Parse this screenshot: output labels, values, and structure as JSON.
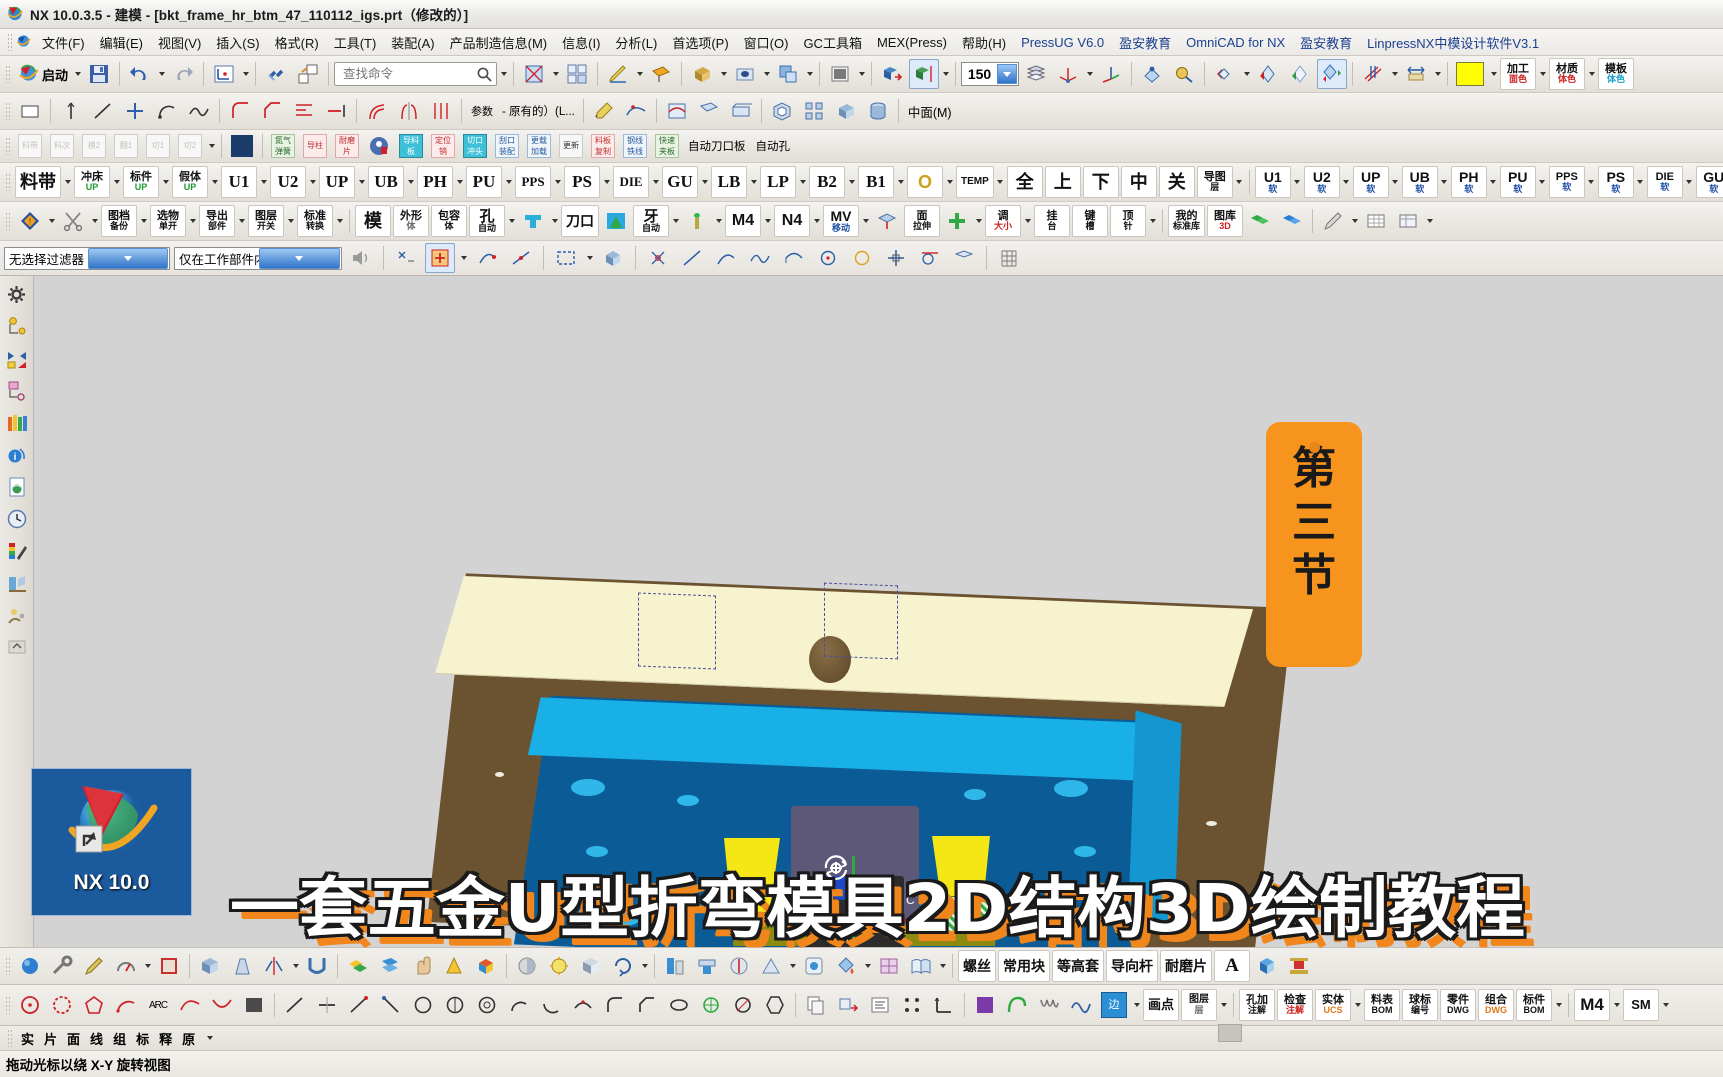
{
  "window": {
    "title": "NX 10.0.3.5 - 建模 - [bkt_frame_hr_btm_47_110112_igs.prt（修改的）]",
    "app_icon": "nx-globe-icon"
  },
  "menubar": {
    "items": [
      {
        "label": "文件(F)",
        "accent": false
      },
      {
        "label": "编辑(E)",
        "accent": false
      },
      {
        "label": "视图(V)",
        "accent": false
      },
      {
        "label": "插入(S)",
        "accent": false
      },
      {
        "label": "格式(R)",
        "accent": false
      },
      {
        "label": "工具(T)",
        "accent": false
      },
      {
        "label": "装配(A)",
        "accent": false
      },
      {
        "label": "产品制造信息(M)",
        "accent": false
      },
      {
        "label": "信息(I)",
        "accent": false
      },
      {
        "label": "分析(L)",
        "accent": false
      },
      {
        "label": "首选项(P)",
        "accent": false
      },
      {
        "label": "窗口(O)",
        "accent": false
      },
      {
        "label": "GC工具箱",
        "accent": false
      },
      {
        "label": "MEX(Press)",
        "accent": false
      },
      {
        "label": "帮助(H)",
        "accent": false
      },
      {
        "label": "PressUG V6.0",
        "accent": true
      },
      {
        "label": "盈安教育",
        "accent": true
      },
      {
        "label": "OmniCAD for NX",
        "accent": true
      },
      {
        "label": "盈安教育",
        "accent": true
      },
      {
        "label": "LinpressNX中模设计软件V3.1",
        "accent": true
      }
    ]
  },
  "toolbar_main": {
    "start_label": "启动",
    "search_placeholder": "查找命令",
    "layer_value": "150",
    "color_swatch": "#ffff00",
    "labeled": [
      {
        "l1": "加工",
        "l2": "面色",
        "c1": "blk",
        "c2": "red"
      },
      {
        "l1": "材质",
        "l2": "体色",
        "c1": "blk",
        "c2": "red"
      },
      {
        "l1": "模板",
        "l2": "体色",
        "c1": "blk",
        "c2": "cyn"
      }
    ]
  },
  "toolbar_press": {
    "left_buttons": [
      {
        "l1": "料带",
        "l2": "",
        "c1": "blk",
        "c2": ""
      },
      {
        "l1": "冲床",
        "l2": "UP",
        "c1": "blk",
        "c2": "grn"
      },
      {
        "l1": "标件",
        "l2": "UP",
        "c1": "blu",
        "c2": "grn"
      },
      {
        "l1": "假体",
        "l2": "UP",
        "c1": "blk",
        "c2": "grn"
      }
    ],
    "codes": [
      "U1",
      "U2",
      "UP",
      "UB",
      "PH",
      "PU",
      "PPS",
      "PS",
      "DIE",
      "GU",
      "LB",
      "LP",
      "B2",
      "B1"
    ],
    "ring_label": "O",
    "temp_label": "TEMP",
    "cn_buttons": [
      "全",
      "上",
      "下",
      "中",
      "关"
    ],
    "layer_btn": {
      "l1": "导图",
      "l2": "层"
    },
    "codes2": [
      "U1",
      "U2",
      "UP",
      "UB",
      "PH",
      "PU",
      "PPS",
      "PS",
      "DIE",
      "GU"
    ],
    "codes2_sub": "软"
  },
  "toolbar_tools": {
    "buttons": [
      {
        "l1": "图档",
        "l2": "备份",
        "c1": "blu",
        "c2": "blk"
      },
      {
        "l1": "选物",
        "l2": "单开",
        "c1": "blu",
        "c2": "blk"
      },
      {
        "l1": "导出",
        "l2": "部件",
        "c1": "blu",
        "c2": "blk"
      },
      {
        "l1": "图层",
        "l2": "开关",
        "c1": "grn",
        "c2": "blk"
      },
      {
        "l1": "标准",
        "l2": "转换",
        "c1": "grn",
        "c2": "blk"
      }
    ],
    "buttons2": [
      {
        "l1": "模",
        "l2": "",
        "c1": "blk",
        "c2": ""
      },
      {
        "l1": "外形",
        "l2": "体",
        "c1": "gry",
        "c2": "gry"
      },
      {
        "l1": "包容",
        "l2": "体",
        "c1": "blk",
        "c2": "blk"
      },
      {
        "l1": "孔",
        "l2": "自动",
        "c1": "grn",
        "c2": "blk"
      },
      {
        "l1": "刀口",
        "l2": "",
        "c1": "blk",
        "c2": ""
      },
      {
        "l1": "牙",
        "l2": "自动",
        "c1": "red",
        "c2": "blk"
      },
      {
        "l1": "M4",
        "l2": "",
        "c1": "blk",
        "c2": ""
      },
      {
        "l1": "N4",
        "l2": "",
        "c1": "red",
        "c2": ""
      },
      {
        "l1": "MV",
        "l2": "移动",
        "c1": "blu",
        "c2": "blu"
      },
      {
        "l1": "面",
        "l2": "拉伸",
        "c1": "blk",
        "c2": "blk"
      },
      {
        "l1": "调",
        "l2": "大小",
        "c1": "blu",
        "c2": "red"
      },
      {
        "l1": "挂",
        "l2": "台",
        "c1": "blk",
        "c2": "blk"
      },
      {
        "l1": "键",
        "l2": "槽",
        "c1": "blk",
        "c2": "blk"
      },
      {
        "l1": "顶",
        "l2": "针",
        "c1": "blk",
        "c2": "blk"
      }
    ],
    "library": [
      {
        "l1": "我的",
        "l2": "标准库",
        "c1": "red",
        "c2": "blk"
      },
      {
        "l1": "图库",
        "l2": "3D",
        "c1": "blu",
        "c2": "red"
      }
    ]
  },
  "selection_bar": {
    "filter_value": "无选择过滤器",
    "scope_value": "仅在工作部件内"
  },
  "resource_bar": {
    "items": [
      {
        "name": "settings-gear",
        "icon": "gear-icon"
      },
      {
        "name": "assembly-navigator",
        "icon": "assembly-icon"
      },
      {
        "name": "constraint-navigator",
        "icon": "constraint-icon"
      },
      {
        "name": "part-navigator",
        "icon": "part-navigator-icon"
      },
      {
        "name": "reuse-library",
        "icon": "books-icon"
      },
      {
        "name": "help-info",
        "icon": "info-icon"
      },
      {
        "name": "html-help",
        "icon": "web-page-icon"
      },
      {
        "name": "history",
        "icon": "clock-icon"
      },
      {
        "name": "system-materials",
        "icon": "palette-icon"
      },
      {
        "name": "process-studio",
        "icon": "process-icon"
      },
      {
        "name": "roles",
        "icon": "roles-icon"
      }
    ]
  },
  "viewport": {
    "rotation_cue": "rotate-about-point-icon",
    "annotations": [
      "dashed-selection-box-left",
      "dashed-selection-box-right"
    ],
    "model_colors": {
      "plate_brown": "#6b5332",
      "plate_top": "#f8f3cf",
      "pad_blue": "#0b5c96",
      "strip_cyan": "#19b0e8",
      "wedge_yellow": "#f5e616",
      "punch_purple": "#5d5878",
      "block_black": "#2c2c2c",
      "background": "#d3d3d3"
    }
  },
  "bottom_toolbar": {
    "text_buttons": [
      "螺丝",
      "常用块",
      "等高套",
      "导向杆",
      "耐磨片"
    ],
    "letter_button": "A",
    "annot_buttons": [
      {
        "l1": "孔加",
        "l2": "注解",
        "c1": "grn",
        "c2": "blk"
      },
      {
        "l1": "检查",
        "l2": "注解",
        "c1": "grn",
        "c2": "red"
      },
      {
        "l1": "实体",
        "l2": "UCS",
        "c1": "blk",
        "c2": "org"
      },
      {
        "l1": "料表",
        "l2": "BOM",
        "c1": "grn",
        "c2": "blk"
      },
      {
        "l1": "球标",
        "l2": "编号",
        "c1": "grn",
        "c2": "blk"
      },
      {
        "l1": "零件",
        "l2": "DWG",
        "c1": "grn",
        "c2": "blk"
      },
      {
        "l1": "组合",
        "l2": "DWG",
        "c1": "grn",
        "c2": "org"
      },
      {
        "l1": "标件",
        "l2": "BOM",
        "c1": "grn",
        "c2": "blk"
      }
    ],
    "m4_label": "M4",
    "sm_label": "SM",
    "draw_buttons": [
      {
        "l1": "画点",
        "l2": "",
        "c1": "blk",
        "c2": ""
      },
      {
        "l1": "图层",
        "l2": "层",
        "c1": "gry",
        "c2": "gry"
      }
    ],
    "edge_label": "边"
  },
  "status_bar": {
    "toggles": [
      "实",
      "片",
      "面",
      "线",
      "组",
      "标",
      "释",
      "原"
    ],
    "cue": "拖动光标以绕 X-Y 旋转视图"
  },
  "desktop_shortcut": {
    "label": "NX 10.0",
    "icon": "nx-globe-shortcut-icon"
  },
  "overlay": {
    "banner_text": "一套五金U型折弯模具2D结构3D绘制教程",
    "banner_fill": "#ffffff",
    "banner_stroke": "#1a1a1a",
    "banner_shadow": "#f0861c",
    "bookmark_text": "第三节",
    "bookmark_chars": [
      "第",
      "三",
      "节"
    ],
    "bookmark_bg": "#f7941e",
    "bookmark_fg": "#1a1a1a"
  }
}
